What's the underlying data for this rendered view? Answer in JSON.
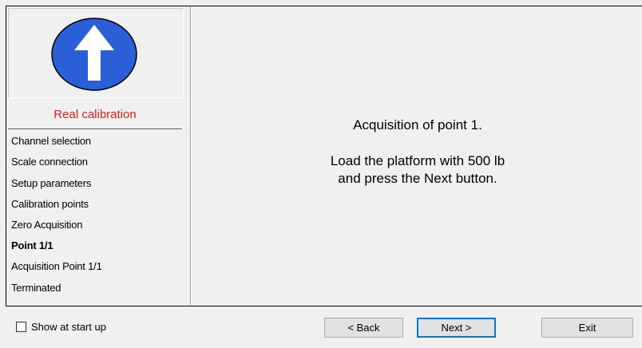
{
  "steps": {
    "title": "Real calibration",
    "items": [
      {
        "label": "Channel selection"
      },
      {
        "label": "Scale connection"
      },
      {
        "label": "Setup parameters"
      },
      {
        "label": "Calibration points"
      },
      {
        "label": "Zero Acquisition"
      },
      {
        "label": "Point 1/1",
        "current": true
      },
      {
        "label": "Acquisition Point 1/1"
      },
      {
        "label": "Terminated"
      }
    ]
  },
  "icon": {
    "name": "up-arrow-icon",
    "fill": "#2a5fd8",
    "arrow": "#ffffff"
  },
  "message": {
    "line1": "Acquisition of point 1.",
    "line2": "Load the platform with 500 lb",
    "line3": "and press the Next button."
  },
  "footer": {
    "show_at_startup_label": "Show at start up",
    "show_at_startup_checked": false,
    "back_label": "< Back",
    "next_label": "Next >",
    "exit_label": "Exit"
  },
  "colors": {
    "step_title": "#e02020",
    "default_button_border": "#0078d7"
  }
}
